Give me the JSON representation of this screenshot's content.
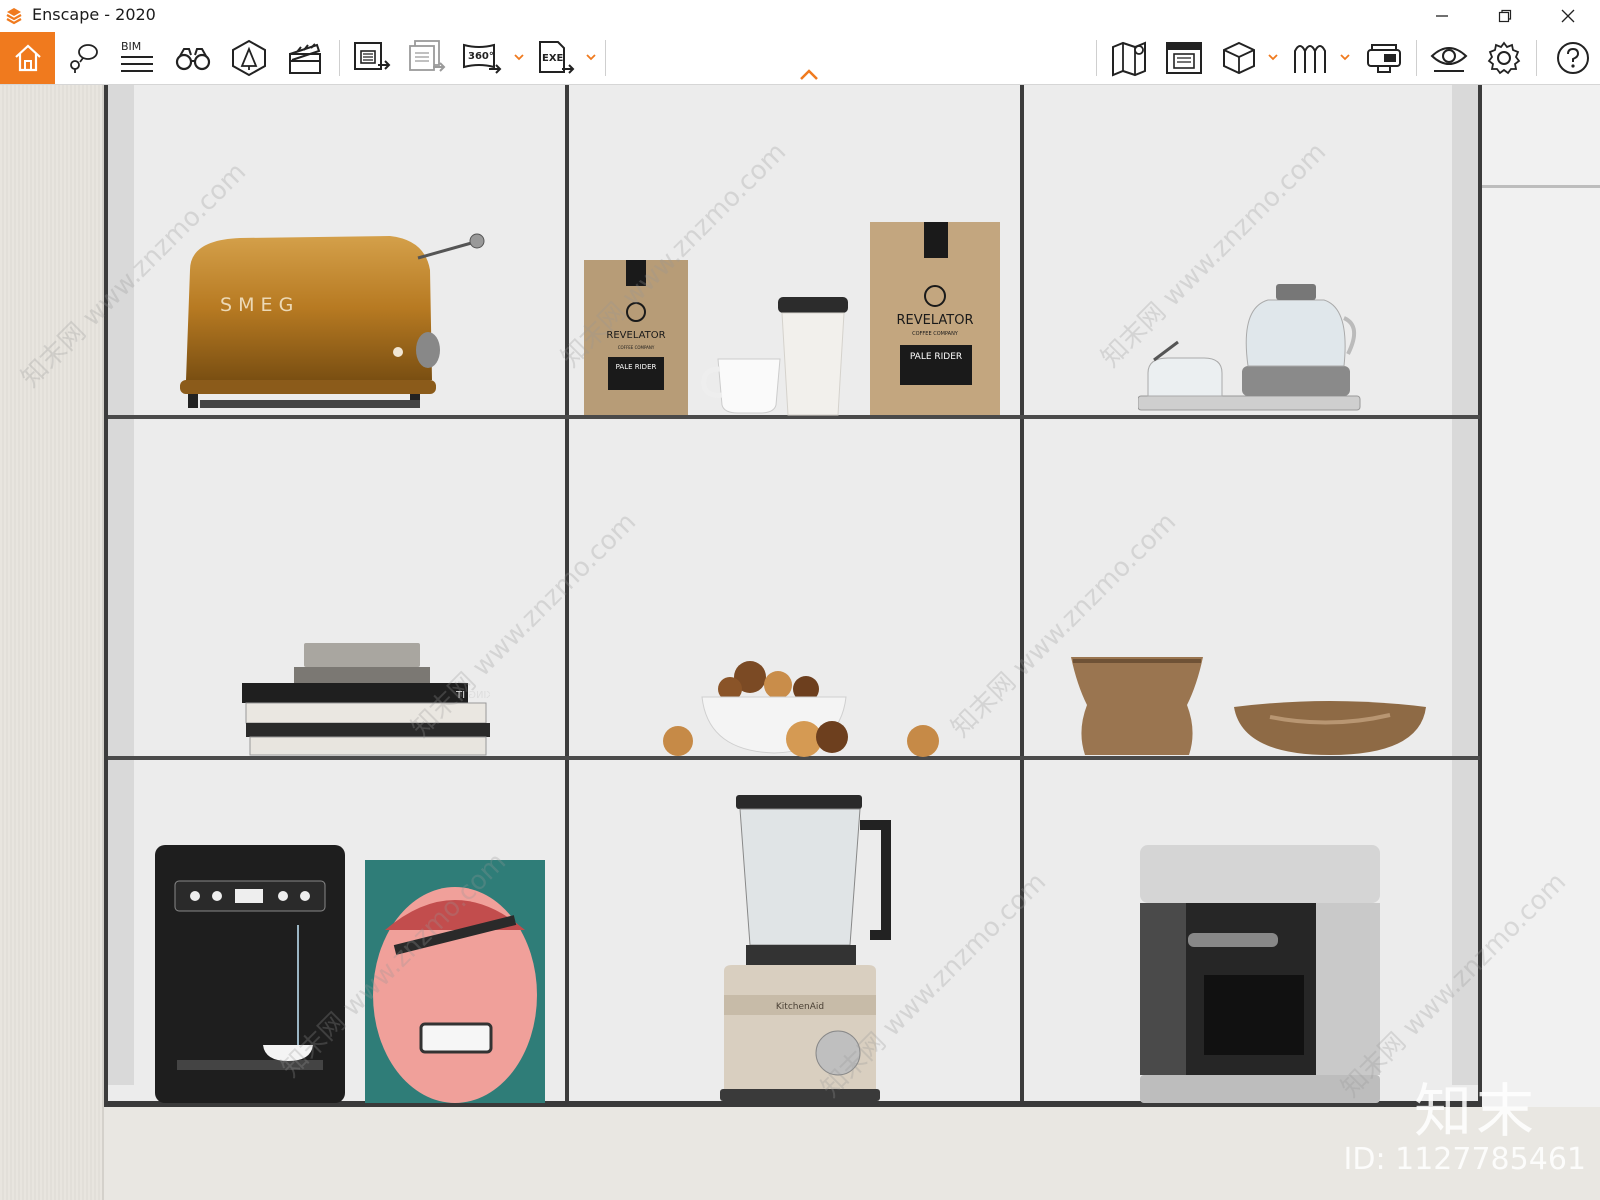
{
  "window": {
    "title": "Enscape - 2020",
    "controls": {
      "minimize": "minimize-icon",
      "restore": "restore-icon",
      "close": "close-icon"
    }
  },
  "toolbar": {
    "accent_color": "#f07a1e",
    "left_buttons": [
      {
        "icon": "home-icon",
        "active": true
      },
      {
        "icon": "location-pin-icon"
      },
      {
        "icon": "bim-info-icon",
        "label": "BIM"
      },
      {
        "icon": "binoculars-icon"
      },
      {
        "icon": "atmosphere-icon"
      },
      {
        "icon": "clapperboard-icon"
      },
      {
        "icon": "render-screenshot-icon"
      },
      {
        "icon": "batch-render-icon"
      },
      {
        "icon": "panorama-360-icon",
        "label": "360°"
      },
      {
        "icon": "export-exe-icon",
        "label": "EXE"
      }
    ],
    "right_buttons": [
      {
        "icon": "map-icon"
      },
      {
        "icon": "material-editor-icon"
      },
      {
        "icon": "asset-library-cube-icon"
      },
      {
        "icon": "views-icon"
      },
      {
        "icon": "vr-headset-icon"
      },
      {
        "icon": "visual-settings-eye-icon"
      },
      {
        "icon": "settings-gear-icon"
      },
      {
        "icon": "help-icon"
      }
    ]
  },
  "scene": {
    "products": {
      "toaster_brand": "S M E G",
      "coffee_bag_brand": "REVELATOR",
      "coffee_bag_sub": "COFFEE COMPANY",
      "coffee_bag_flavor": "PALE RIDER",
      "book_title": "MAKING IT",
      "blender_brand": "KitchenAid"
    },
    "watermark_text": "知末网 www.znzmo.com",
    "brand_watermark": "知末",
    "id_watermark": "ID: 1127785461"
  }
}
